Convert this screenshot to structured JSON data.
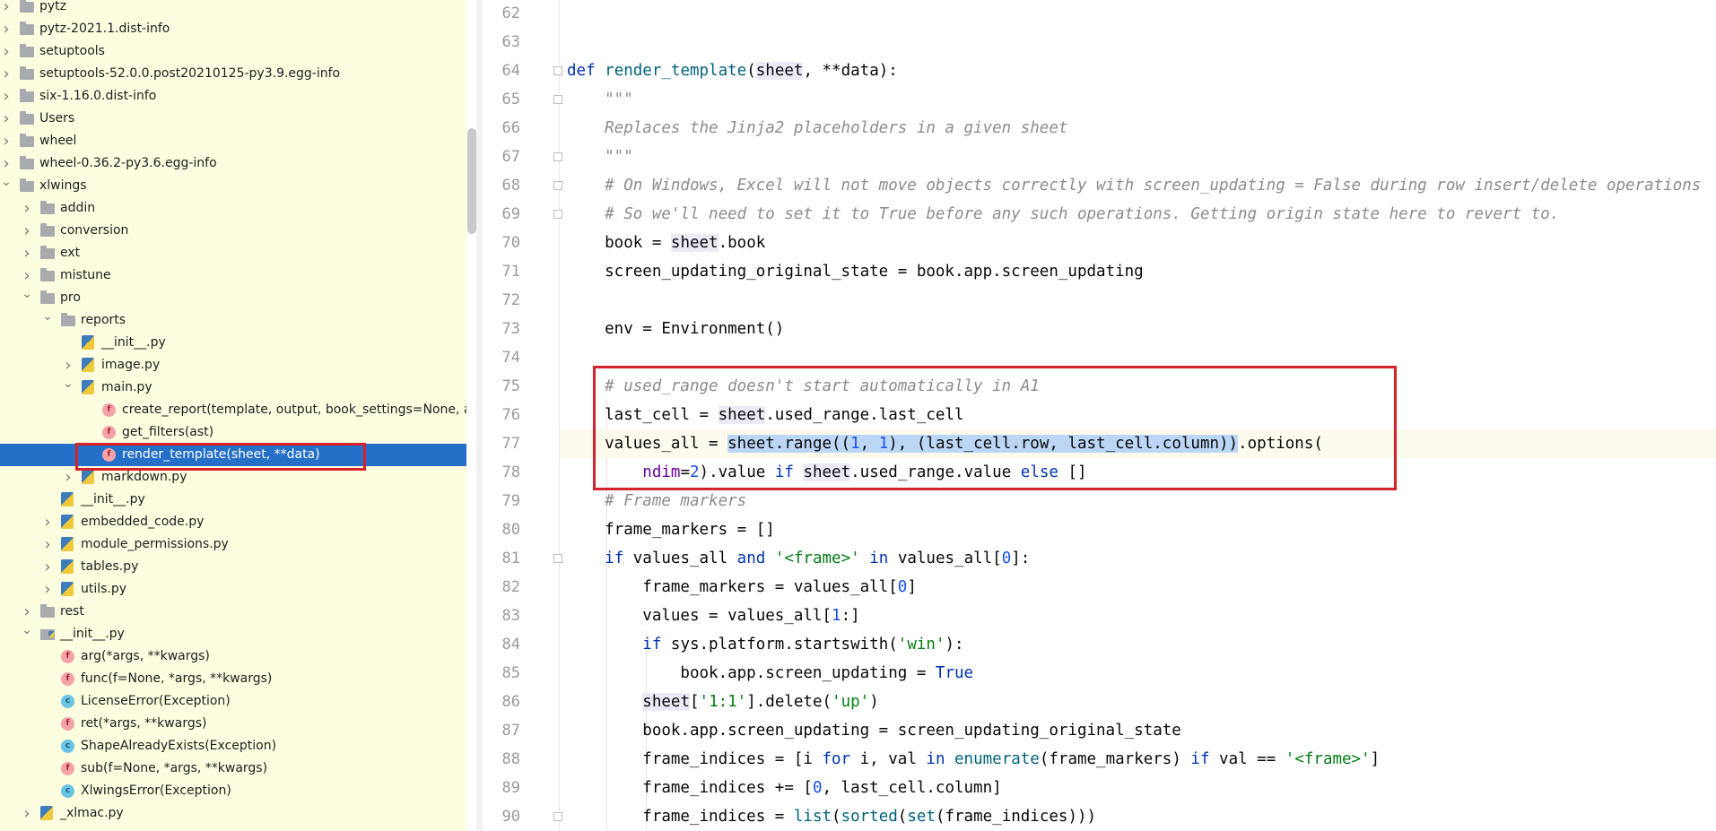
{
  "tree": {
    "items": [
      {
        "label": "pytz",
        "indent": 0,
        "icon": "folder-icon",
        "arrow": "right"
      },
      {
        "label": "pytz-2021.1.dist-info",
        "indent": 0,
        "icon": "folder-icon",
        "arrow": "right"
      },
      {
        "label": "setuptools",
        "indent": 0,
        "icon": "folder-icon",
        "arrow": "right"
      },
      {
        "label": "setuptools-52.0.0.post20210125-py3.9.egg-info",
        "indent": 0,
        "icon": "folder-icon",
        "arrow": "right"
      },
      {
        "label": "six-1.16.0.dist-info",
        "indent": 0,
        "icon": "folder-icon",
        "arrow": "right"
      },
      {
        "label": "Users",
        "indent": 0,
        "icon": "folder-icon",
        "arrow": "right"
      },
      {
        "label": "wheel",
        "indent": 0,
        "icon": "folder-icon",
        "arrow": "right"
      },
      {
        "label": "wheel-0.36.2-py3.6.egg-info",
        "indent": 0,
        "icon": "folder-icon",
        "arrow": "right"
      },
      {
        "label": "xlwings",
        "indent": 0,
        "icon": "folder-icon",
        "arrow": "down"
      },
      {
        "label": "addin",
        "indent": 1,
        "icon": "folder-icon",
        "arrow": "right"
      },
      {
        "label": "conversion",
        "indent": 1,
        "icon": "folder-icon",
        "arrow": "right"
      },
      {
        "label": "ext",
        "indent": 1,
        "icon": "folder-icon",
        "arrow": "right"
      },
      {
        "label": "mistune",
        "indent": 1,
        "icon": "folder-icon",
        "arrow": "right"
      },
      {
        "label": "pro",
        "indent": 1,
        "icon": "folder-icon",
        "arrow": "down"
      },
      {
        "label": "reports",
        "indent": 2,
        "icon": "folder-icon",
        "arrow": "down"
      },
      {
        "label": "__init__.py",
        "indent": 3,
        "icon": "python-file-icon",
        "arrow": ""
      },
      {
        "label": "image.py",
        "indent": 3,
        "icon": "python-file-icon",
        "arrow": "right"
      },
      {
        "label": "main.py",
        "indent": 3,
        "icon": "python-file-icon",
        "arrow": "down"
      },
      {
        "label": "create_report(template, output, book_settings=None, app=None, **data)",
        "indent": 4,
        "icon": "function-icon",
        "arrow": ""
      },
      {
        "label": "get_filters(ast)",
        "indent": 4,
        "icon": "function-icon",
        "arrow": ""
      },
      {
        "label": "render_template(sheet, **data)",
        "indent": 4,
        "icon": "function-icon",
        "arrow": "",
        "selected": true
      },
      {
        "label": "markdown.py",
        "indent": 3,
        "icon": "python-file-icon",
        "arrow": "right"
      },
      {
        "label": "__init__.py",
        "indent": 2,
        "icon": "python-file-icon",
        "arrow": ""
      },
      {
        "label": "embedded_code.py",
        "indent": 2,
        "icon": "python-file-icon",
        "arrow": "right"
      },
      {
        "label": "module_permissions.py",
        "indent": 2,
        "icon": "python-file-icon",
        "arrow": "right"
      },
      {
        "label": "tables.py",
        "indent": 2,
        "icon": "python-file-icon",
        "arrow": "right"
      },
      {
        "label": "utils.py",
        "indent": 2,
        "icon": "python-file-icon",
        "arrow": "right"
      },
      {
        "label": "rest",
        "indent": 1,
        "icon": "folder-icon",
        "arrow": "right"
      },
      {
        "label": "__init__.py",
        "indent": 1,
        "icon": "python-package-icon",
        "arrow": "down"
      },
      {
        "label": "arg(*args, **kwargs)",
        "indent": 2,
        "icon": "function-icon",
        "arrow": ""
      },
      {
        "label": "func(f=None, *args, **kwargs)",
        "indent": 2,
        "icon": "function-icon",
        "arrow": ""
      },
      {
        "label": "LicenseError(Exception)",
        "indent": 2,
        "icon": "class-icon",
        "arrow": ""
      },
      {
        "label": "ret(*args, **kwargs)",
        "indent": 2,
        "icon": "function-icon",
        "arrow": ""
      },
      {
        "label": "ShapeAlreadyExists(Exception)",
        "indent": 2,
        "icon": "class-icon",
        "arrow": ""
      },
      {
        "label": "sub(f=None, *args, **kwargs)",
        "indent": 2,
        "icon": "function-icon",
        "arrow": ""
      },
      {
        "label": "XlwingsError(Exception)",
        "indent": 2,
        "icon": "class-icon",
        "arrow": ""
      },
      {
        "label": "_xlmac.py",
        "indent": 1,
        "icon": "python-file-icon",
        "arrow": "right"
      }
    ]
  },
  "icon_letters": {
    "function": "f",
    "class": "c"
  },
  "editor": {
    "current_line": 77,
    "lines": [
      {
        "n": "62",
        "fold": false,
        "segs": []
      },
      {
        "n": "63",
        "fold": false,
        "segs": []
      },
      {
        "n": "64",
        "fold": true,
        "segs": [
          [
            "kw",
            "def "
          ],
          [
            "fnn",
            "render_template"
          ],
          [
            "",
            "("
          ],
          [
            "sf",
            "sheet"
          ],
          [
            "",
            ", **data):"
          ]
        ]
      },
      {
        "n": "65",
        "fold": true,
        "segs": [
          [
            "doc",
            "    \"\"\""
          ]
        ]
      },
      {
        "n": "66",
        "fold": false,
        "segs": [
          [
            "doc",
            "    Replaces the Jinja2 placeholders in a given sheet"
          ]
        ]
      },
      {
        "n": "67",
        "fold": true,
        "segs": [
          [
            "doc",
            "    \"\"\""
          ]
        ]
      },
      {
        "n": "68",
        "fold": true,
        "segs": [
          [
            "cm",
            "    # On Windows, Excel will not move objects correctly with screen_updating = False during row insert/delete operations"
          ]
        ]
      },
      {
        "n": "69",
        "fold": true,
        "segs": [
          [
            "cm",
            "    # So we'll need to set it to True before any such operations. Getting origin state here to revert to."
          ]
        ]
      },
      {
        "n": "70",
        "fold": false,
        "segs": [
          [
            "",
            "    book = "
          ],
          [
            "sf",
            "sheet"
          ],
          [
            "",
            ".book"
          ]
        ]
      },
      {
        "n": "71",
        "fold": false,
        "segs": [
          [
            "",
            "    screen_updating_original_state = book.app.screen_updating"
          ]
        ]
      },
      {
        "n": "72",
        "fold": false,
        "segs": []
      },
      {
        "n": "73",
        "fold": false,
        "segs": [
          [
            "",
            "    env = Environment()"
          ]
        ]
      },
      {
        "n": "74",
        "fold": false,
        "segs": []
      },
      {
        "n": "75",
        "fold": false,
        "segs": [
          [
            "cm",
            "    # used_range doesn't start automatically in A1"
          ]
        ]
      },
      {
        "n": "76",
        "fold": false,
        "segs": [
          [
            "",
            "    last_cell = "
          ],
          [
            "sf",
            "sheet"
          ],
          [
            "",
            ".used_range.last_cell"
          ]
        ]
      },
      {
        "n": "77",
        "fold": false,
        "segs": [
          [
            "",
            "    values_all = "
          ],
          [
            "hl",
            "sheet.range(("
          ],
          [
            "hl num",
            "1"
          ],
          [
            "hl",
            ", "
          ],
          [
            "hl num",
            "1"
          ],
          [
            "hl",
            "), (last_cell.row, last_cell.column))"
          ],
          [
            "",
            ".options("
          ]
        ]
      },
      {
        "n": "78",
        "fold": false,
        "segs": [
          [
            "",
            "        "
          ],
          [
            "param",
            "ndim"
          ],
          [
            "",
            "="
          ],
          [
            "num",
            "2"
          ],
          [
            "",
            ").value "
          ],
          [
            "kw",
            "if "
          ],
          [
            "sf",
            "sheet"
          ],
          [
            "",
            ".used_range.value "
          ],
          [
            "kw",
            "else"
          ],
          [
            "",
            " []"
          ]
        ]
      },
      {
        "n": "79",
        "fold": false,
        "segs": [
          [
            "cm",
            "    # Frame markers"
          ]
        ]
      },
      {
        "n": "80",
        "fold": false,
        "segs": [
          [
            "",
            "    frame_markers = []"
          ]
        ]
      },
      {
        "n": "81",
        "fold": true,
        "segs": [
          [
            "",
            "    "
          ],
          [
            "kw",
            "if "
          ],
          [
            "",
            "values_all "
          ],
          [
            "kw",
            "and "
          ],
          [
            "str",
            "'<frame>'"
          ],
          [
            "kw",
            " in "
          ],
          [
            "",
            "values_all["
          ],
          [
            "num",
            "0"
          ],
          [
            "",
            "]:"
          ]
        ]
      },
      {
        "n": "82",
        "fold": false,
        "segs": [
          [
            "",
            "        frame_markers = values_all["
          ],
          [
            "num",
            "0"
          ],
          [
            "",
            "]"
          ]
        ]
      },
      {
        "n": "83",
        "fold": false,
        "segs": [
          [
            "",
            "        values = values_all["
          ],
          [
            "num",
            "1"
          ],
          [
            "",
            ":]"
          ]
        ]
      },
      {
        "n": "84",
        "fold": false,
        "segs": [
          [
            "",
            "        "
          ],
          [
            "kw",
            "if "
          ],
          [
            "",
            "sys.platform.startswith("
          ],
          [
            "str",
            "'win'"
          ],
          [
            "",
            "):"
          ]
        ]
      },
      {
        "n": "85",
        "fold": false,
        "segs": [
          [
            "",
            "            book.app.screen_updating = "
          ],
          [
            "kw",
            "True"
          ]
        ]
      },
      {
        "n": "86",
        "fold": false,
        "segs": [
          [
            "",
            "        "
          ],
          [
            "sf",
            "sheet"
          ],
          [
            "",
            "["
          ],
          [
            "str",
            "'1:1'"
          ],
          [
            "",
            "].delete("
          ],
          [
            "str",
            "'up'"
          ],
          [
            "",
            ")"
          ]
        ]
      },
      {
        "n": "87",
        "fold": false,
        "segs": [
          [
            "",
            "        book.app.screen_updating = screen_updating_original_state"
          ]
        ]
      },
      {
        "n": "88",
        "fold": false,
        "segs": [
          [
            "",
            "        frame_indices = [i "
          ],
          [
            "kw",
            "for "
          ],
          [
            "",
            "i, val "
          ],
          [
            "kw",
            "in "
          ],
          [
            "fnn",
            "enumerate"
          ],
          [
            "",
            "(frame_markers) "
          ],
          [
            "kw",
            "if "
          ],
          [
            "",
            "val == "
          ],
          [
            "str",
            "'<frame>'"
          ],
          [
            "",
            "]"
          ]
        ]
      },
      {
        "n": "89",
        "fold": false,
        "segs": [
          [
            "",
            "        frame_indices += ["
          ],
          [
            "num",
            "0"
          ],
          [
            "",
            ", last_cell.column]"
          ]
        ]
      },
      {
        "n": "90",
        "fold": true,
        "segs": [
          [
            "",
            "        frame_indices = "
          ],
          [
            "fnn",
            "list"
          ],
          [
            "",
            "("
          ],
          [
            "fnn",
            "sorted"
          ],
          [
            "",
            "("
          ],
          [
            "fnn",
            "set"
          ],
          [
            "",
            "(frame_indices)))"
          ]
        ]
      }
    ]
  },
  "colors": {
    "selection": "#2470c8",
    "tree_bg": "#fdfde0",
    "annotation_box": "#d6202a",
    "keyword": "#0033b3"
  }
}
